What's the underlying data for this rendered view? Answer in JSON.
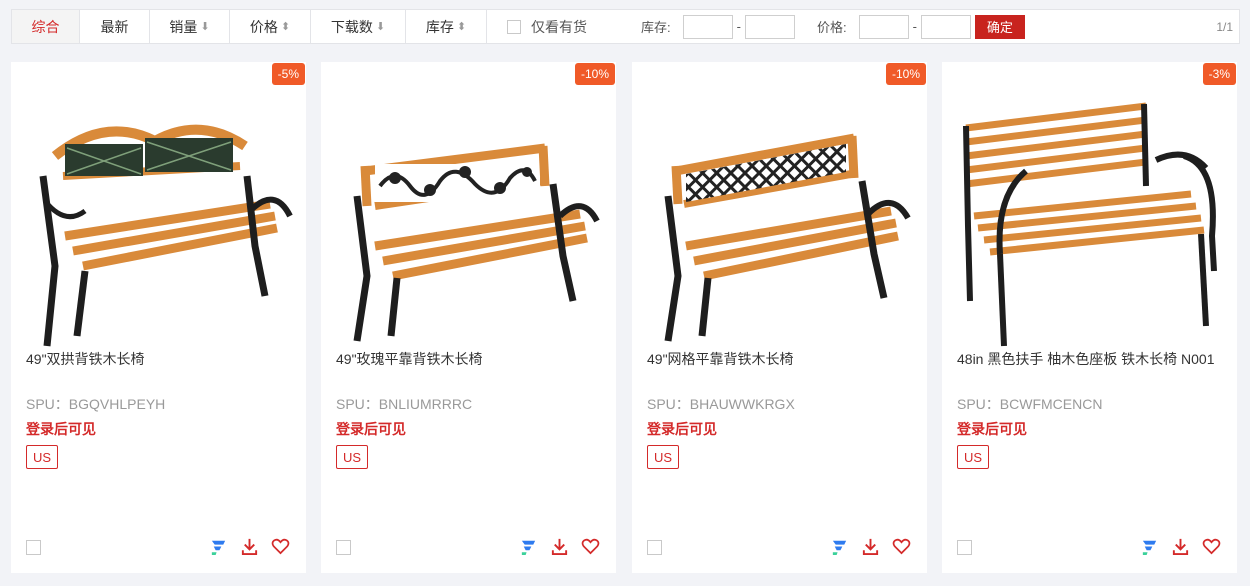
{
  "toolbar": {
    "tabs": [
      {
        "label": "综合",
        "arrow": ""
      },
      {
        "label": "最新",
        "arrow": ""
      },
      {
        "label": "销量",
        "arrow": "⬇"
      },
      {
        "label": "价格",
        "arrow": "⬍"
      },
      {
        "label": "下载数",
        "arrow": "⬇"
      },
      {
        "label": "库存",
        "arrow": "⬍"
      }
    ],
    "in_stock_label": "仅看有货",
    "stock_label": "库存:",
    "price_label": "价格:",
    "range_dash": "-",
    "confirm_label": "确定",
    "pager": "1/1"
  },
  "products": [
    {
      "discount": "-5%",
      "title": "49\"双拱背铁木长椅",
      "spu": "SPU：BGQVHLPEYH",
      "login_tip": "登录后可见",
      "region": "US"
    },
    {
      "discount": "-10%",
      "title": "49\"玫瑰平靠背铁木长椅",
      "spu": "SPU：BNLIUMRRRC",
      "login_tip": "登录后可见",
      "region": "US"
    },
    {
      "discount": "-10%",
      "title": "49\"网格平靠背铁木长椅",
      "spu": "SPU：BHAUWWKRGX",
      "login_tip": "登录后可见",
      "region": "US"
    },
    {
      "discount": "-3%",
      "title": "48in 黑色扶手 柚木色座板 铁木长椅 N001",
      "spu": "SPU：BCWFMCENCN",
      "login_tip": "登录后可见",
      "region": "US"
    }
  ],
  "colors": {
    "accent": "#d42a2a",
    "badge": "#f05a28",
    "wood": "#d98a3a",
    "iron": "#1e1e1e"
  }
}
